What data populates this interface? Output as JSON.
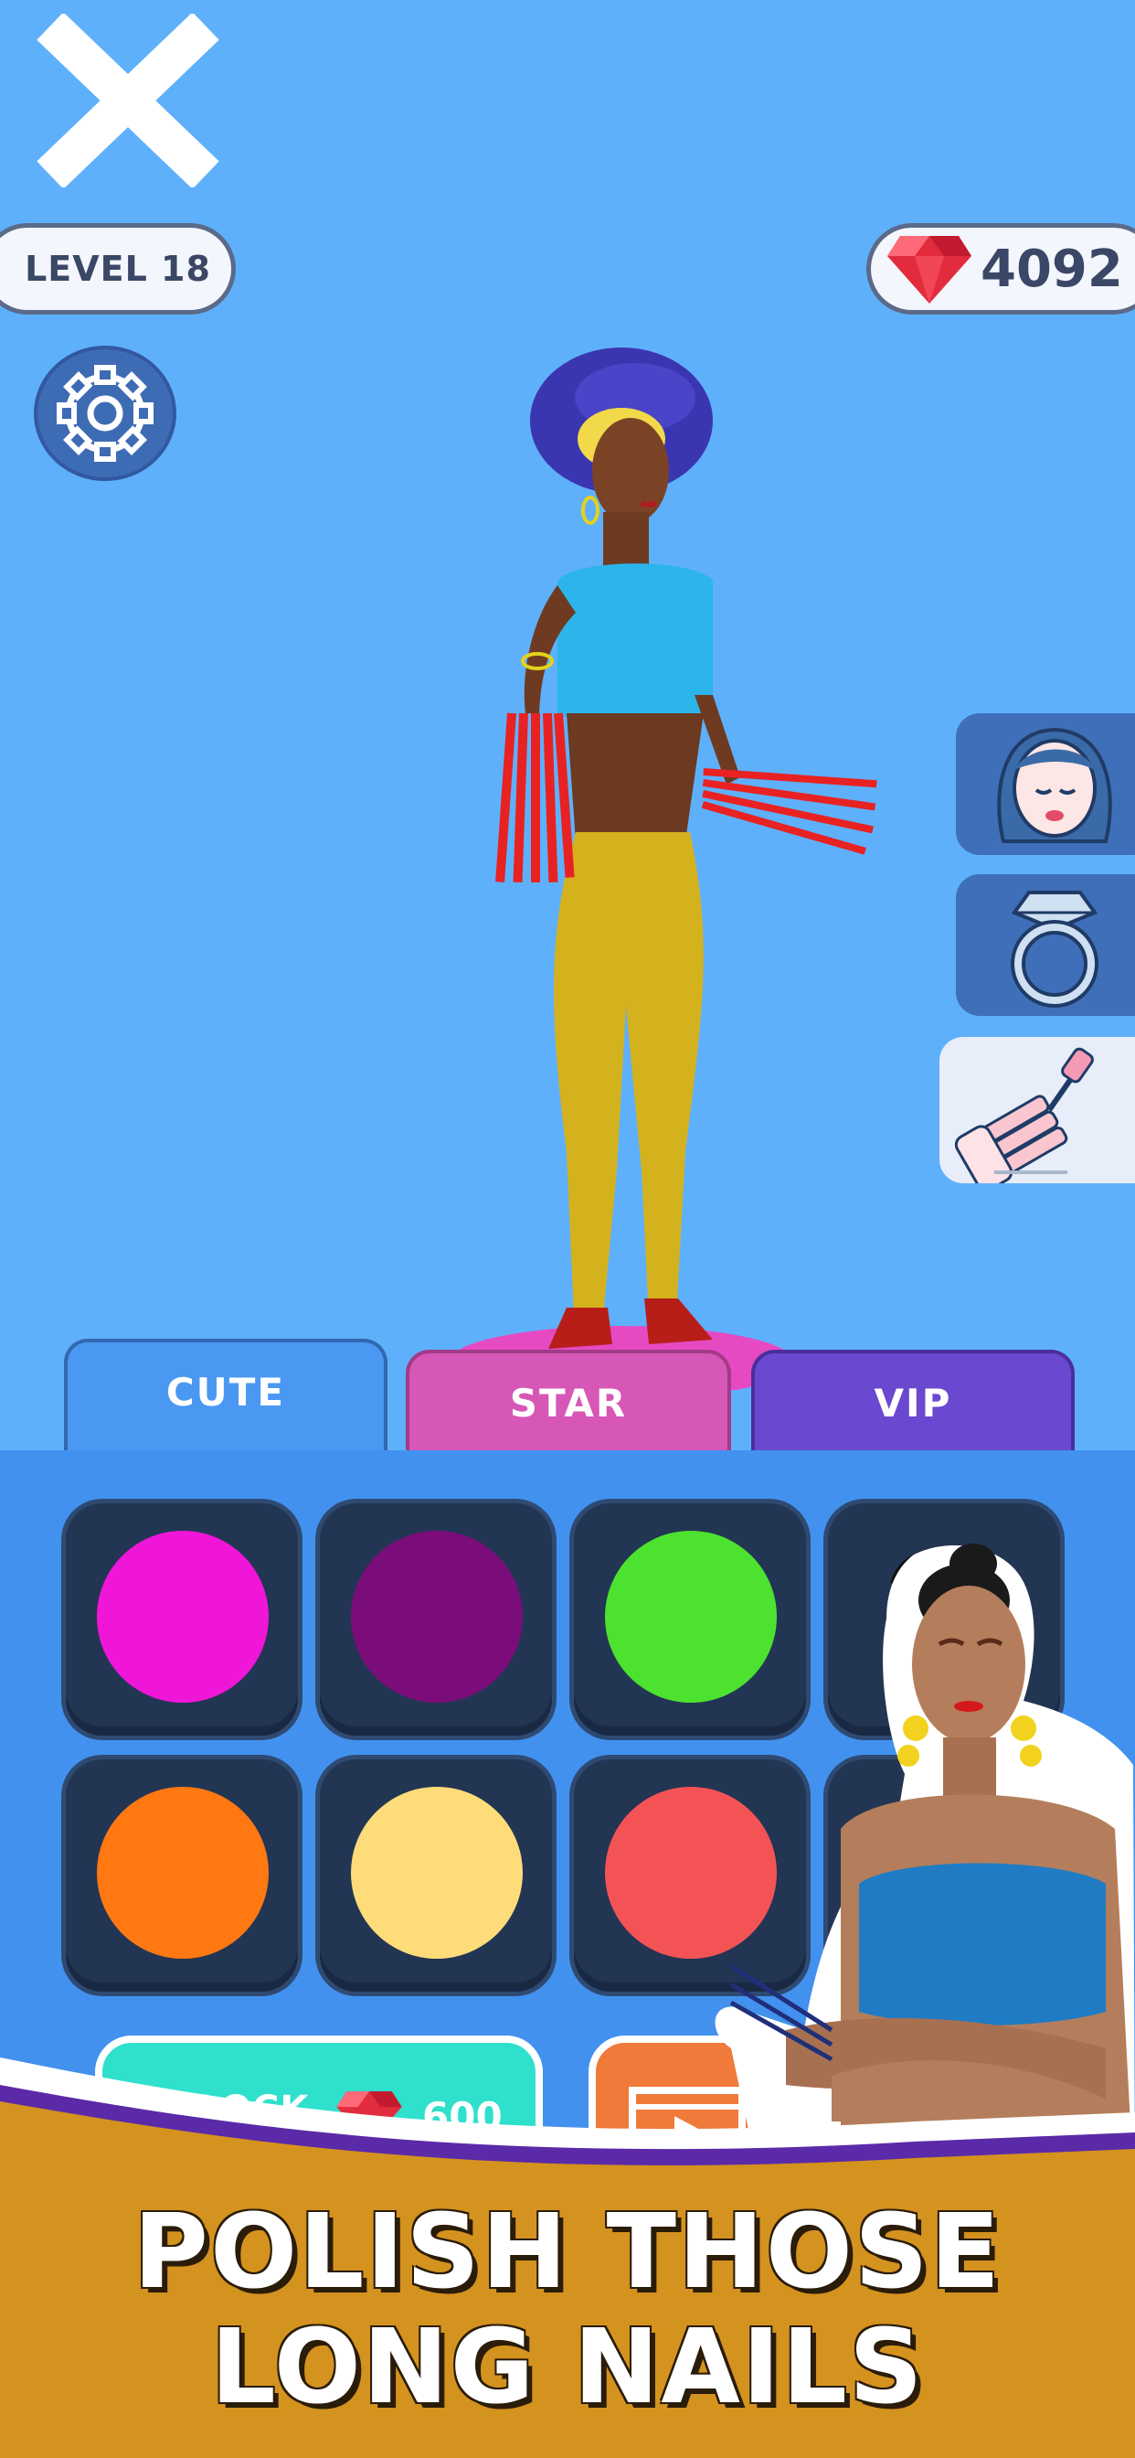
{
  "hud": {
    "level_label": "LEVEL 18",
    "gems": "4092"
  },
  "tabs": [
    {
      "label": "CUTE",
      "color": "#4a98f2",
      "selected": true
    },
    {
      "label": "STAR",
      "color": "#d657b6",
      "selected": false
    },
    {
      "label": "VIP",
      "color": "#6b48d0",
      "selected": false
    }
  ],
  "side_menu": [
    "face-icon",
    "ring-icon",
    "nail-polish-icon"
  ],
  "swatches": [
    {
      "color": "#ef16d8",
      "locked": false
    },
    {
      "color": "#7b0d7a",
      "locked": false
    },
    {
      "color": "#4de22f",
      "locked": false
    },
    {
      "color": "#1c2d47",
      "locked": true
    },
    {
      "color": "#ff7812",
      "locked": false
    },
    {
      "color": "#ffdc7a",
      "locked": false
    },
    {
      "color": "#f45356",
      "locked": false
    },
    {
      "color": "#1c2d47",
      "locked": true
    }
  ],
  "unlock": {
    "label": "UNLOCK",
    "price": "600"
  },
  "banner": {
    "line1": "POLISH THOSE",
    "line2": "LONG NAILS",
    "color": "#d4921f"
  }
}
